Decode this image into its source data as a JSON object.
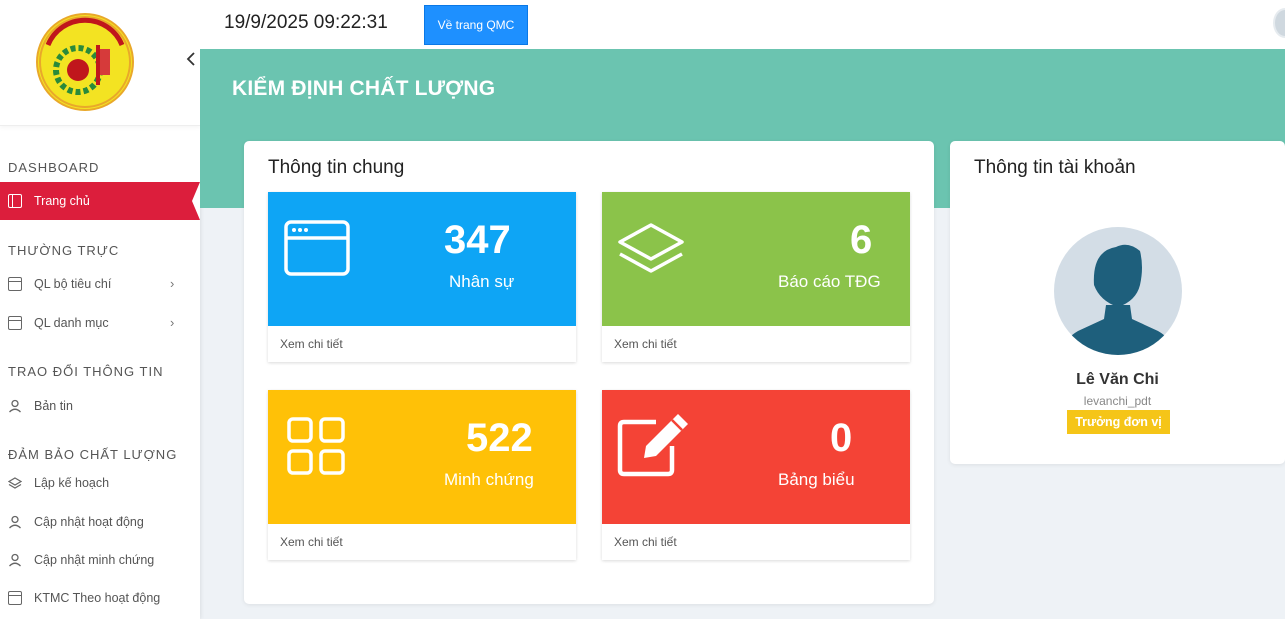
{
  "topbar": {
    "datetime": "19/9/2025 09:22:31",
    "qmc_button": "Về trang QMC"
  },
  "sidebar": {
    "sections": [
      {
        "title": "DASHBOARD",
        "items": [
          {
            "label": "Trang chủ",
            "icon": "layout-icon",
            "active": true
          }
        ]
      },
      {
        "title": "THƯỜNG TRỰC",
        "items": [
          {
            "label": "QL bộ tiêu chí",
            "icon": "folder-icon",
            "has_submenu": true
          },
          {
            "label": "QL danh mục",
            "icon": "folder-icon",
            "has_submenu": true
          }
        ]
      },
      {
        "title": "TRAO ĐỔI THÔNG TIN",
        "items": [
          {
            "label": "Bản tin",
            "icon": "user-icon"
          }
        ]
      },
      {
        "title": "ĐẢM BẢO CHẤT LƯỢNG",
        "items": [
          {
            "label": "Lập kế hoạch",
            "icon": "layers-icon"
          },
          {
            "label": "Cập nhật hoạt động",
            "icon": "user-icon"
          },
          {
            "label": "Cập nhật minh chứng",
            "icon": "user-icon"
          },
          {
            "label": "KTMC Theo hoạt động",
            "icon": "calendar-icon"
          }
        ]
      }
    ]
  },
  "banner": {
    "title": "KIỂM ĐỊNH CHẤT LƯỢNG"
  },
  "general_info": {
    "title": "Thông tin chung",
    "tiles": [
      {
        "value": "347",
        "label": "Nhân sự",
        "link": "Xem chi tiết",
        "color": "#0ea5f5",
        "icon": "browser-window-icon"
      },
      {
        "value": "6",
        "label": "Báo cáo TĐG",
        "link": "Xem chi tiết",
        "color": "#8bc34a",
        "icon": "layers-icon"
      },
      {
        "value": "522",
        "label": "Minh chứng",
        "link": "Xem chi tiết",
        "color": "#ffc107",
        "icon": "grid-icon"
      },
      {
        "value": "0",
        "label": "Bảng biểu",
        "link": "Xem chi tiết",
        "color": "#f44336",
        "icon": "edit-icon"
      }
    ]
  },
  "account": {
    "title": "Thông tin tài khoản",
    "name": "Lê Văn Chi",
    "username": "levanchi_pdt",
    "role": "Trưởng đơn vị"
  },
  "colors": {
    "accent_active": "#dc1e3c",
    "banner": "#6bc4b0",
    "qmc_button": "#1e90ff",
    "role_badge": "#f5c518"
  }
}
